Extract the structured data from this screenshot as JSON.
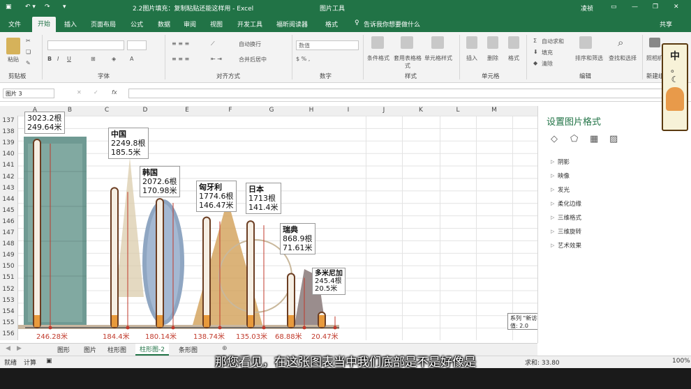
{
  "window": {
    "title": "2.2图片填充：复制粘贴还能这样用 - Excel",
    "tools_label": "图片工具",
    "user": "凌祯",
    "share": "共享"
  },
  "ribbon_tabs": [
    "文件",
    "开始",
    "插入",
    "页面布局",
    "公式",
    "数据",
    "审阅",
    "视图",
    "开发工具",
    "福昕阅读器",
    "格式"
  ],
  "tell_me": "告诉我你想要做什么",
  "ribbon": {
    "groups": [
      "剪贴板",
      "字体",
      "对齐方式",
      "数字",
      "样式",
      "单元格",
      "编辑"
    ],
    "paste": "粘贴",
    "wrap_text": "自动换行",
    "merge_center": "合并后居中",
    "number_format": "数值",
    "cond_format": "条件格式",
    "table_format": "套用表格格式",
    "cell_style": "单元格样式",
    "insert": "插入",
    "delete": "删除",
    "format": "格式",
    "autosum": "自动求和",
    "fill": "填充",
    "clear": "清除",
    "sort_filter": "排序和筛选",
    "find_select": "查找和选择",
    "new_group": "新建组",
    "photo": "照相机"
  },
  "formula_bar": {
    "name_box": "图片 3",
    "fx": "fx"
  },
  "columns": [
    "A",
    "B",
    "C",
    "D",
    "E",
    "F",
    "G",
    "H",
    "I",
    "J",
    "K",
    "L",
    "M"
  ],
  "rows": [
    "137",
    "138",
    "139",
    "140",
    "141",
    "142",
    "143",
    "144",
    "145",
    "146",
    "147",
    "148",
    "149",
    "150",
    "151",
    "152",
    "153",
    "154",
    "155",
    "156"
  ],
  "chart_data": {
    "type": "bar",
    "categories": [
      "",
      "中国",
      "韩国",
      "匈牙利",
      "日本",
      "瑞典",
      "多米尼加"
    ],
    "values_count": [
      3023.2,
      2249.8,
      2072.6,
      1774.6,
      1713,
      868.9,
      245.4
    ],
    "values_length": [
      249.64,
      185.5,
      170.98,
      146.47,
      141.4,
      71.61,
      20.5
    ],
    "callouts": [
      {
        "country": "",
        "count": "3023.2根",
        "length": "249.64米"
      },
      {
        "country": "中国",
        "count": "2249.8根",
        "length": "185.5米"
      },
      {
        "country": "韩国",
        "count": "2072.6根",
        "length": "170.98米"
      },
      {
        "country": "匈牙利",
        "count": "1774.6根",
        "length": "146.47米"
      },
      {
        "country": "日本",
        "count": "1713根",
        "length": "141.4米"
      },
      {
        "country": "瑞典",
        "count": "868.9根",
        "length": "71.61米"
      },
      {
        "country": "多米尼加",
        "count": "245.4根",
        "length": "20.5米"
      }
    ],
    "bottom_labels": [
      "246.28米",
      "184.4米",
      "180.14米",
      "138.74米",
      "135.03米",
      "68.88米",
      "20.47米"
    ]
  },
  "panel": {
    "title": "设置图片格式",
    "items": [
      "阴影",
      "映像",
      "发光",
      "柔化边缘",
      "三维格式",
      "三维旋转",
      "艺术效果"
    ]
  },
  "tooltip": {
    "line1": "系列 \"新访客\" 点 \"PC\"",
    "line2": "值: 2.0"
  },
  "sheet_tabs": [
    "图形",
    "图片",
    "柱形图",
    "柱形图-2",
    "条形图"
  ],
  "active_sheet": "柱形图-2",
  "status": {
    "ready": "就绪",
    "calc": "计算",
    "sum": "求和: 33.80",
    "zoom": "100%"
  },
  "subtitle": "那您看见，在这张图表当中我们底部是不是好像是",
  "floaty": {
    "line1": "中",
    "line2": "。"
  }
}
